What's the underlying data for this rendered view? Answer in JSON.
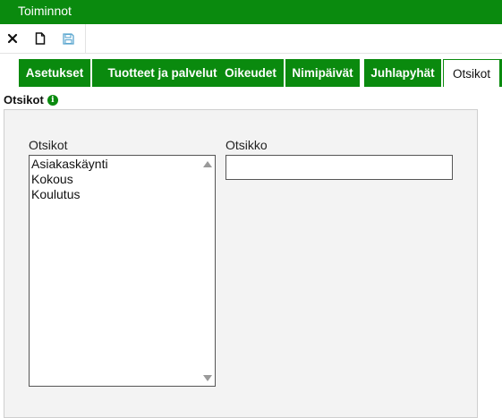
{
  "window": {
    "title": "Toiminnot"
  },
  "toolbar": {
    "close_icon": "close-icon",
    "new_icon": "new-document-icon",
    "save_icon": "save-icon"
  },
  "tabs": [
    {
      "label": "Asetukset",
      "active": false
    },
    {
      "label": "Tuotteet ja palvelut",
      "active": false
    },
    {
      "label": "Oikeudet",
      "active": false
    },
    {
      "label": "Nimipäivät",
      "active": false
    },
    {
      "label": "Juhlapyhät",
      "active": false
    },
    {
      "label": "Otsikot",
      "active": true
    }
  ],
  "section": {
    "title": "Otsikot",
    "info_icon": "info-icon"
  },
  "form": {
    "list_label": "Otsikot",
    "list_items": [
      "Asiakaskäynti",
      "Kokous",
      "Koulutus"
    ],
    "input_label": "Otsikko",
    "input_value": ""
  },
  "colors": {
    "brand_green": "#0a8a0e",
    "panel_bg": "#f3f3f3"
  }
}
